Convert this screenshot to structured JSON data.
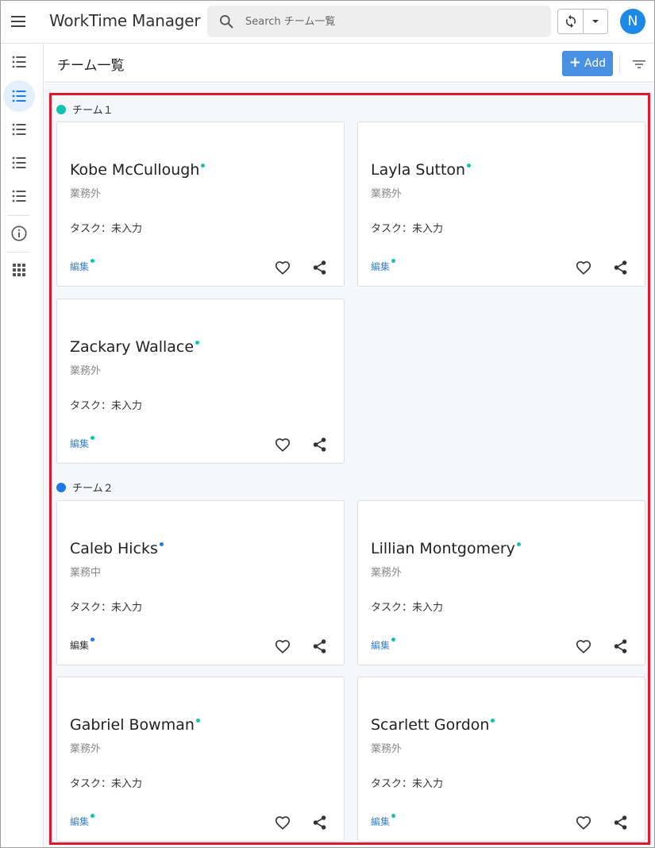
{
  "app": {
    "title": "WorkTime Manager",
    "user_initial": "N"
  },
  "search": {
    "placeholder": "Search チーム一覧"
  },
  "header": {
    "title": "チーム一覧",
    "add_label": "Add"
  },
  "colors": {
    "team1": "#12c2b0",
    "team2": "#1e78e6",
    "accent": "#4a90e2",
    "highlight": "#e0182d"
  },
  "teams": [
    {
      "name": "チーム１",
      "members": [
        {
          "name": "Kobe McCullough",
          "status": "業務外",
          "task": "タスク：未入力",
          "edit": "編集"
        },
        {
          "name": "Layla Sutton",
          "status": "業務外",
          "task": "タスク：未入力",
          "edit": "編集"
        },
        {
          "name": "Zackary Wallace",
          "status": "業務外",
          "task": "タスク：未入力",
          "edit": "編集"
        }
      ]
    },
    {
      "name": "チーム２",
      "members": [
        {
          "name": "Caleb Hicks",
          "status": "業務中",
          "task": "タスク：未入力",
          "edit": "編集"
        },
        {
          "name": "Lillian Montgomery",
          "status": "業務外",
          "task": "タスク：未入力",
          "edit": "編集"
        },
        {
          "name": "Gabriel Bowman",
          "status": "業務外",
          "task": "タスク：未入力",
          "edit": "編集"
        },
        {
          "name": "Scarlett Gordon",
          "status": "業務外",
          "task": "タスク：未入力",
          "edit": "編集"
        }
      ]
    }
  ]
}
